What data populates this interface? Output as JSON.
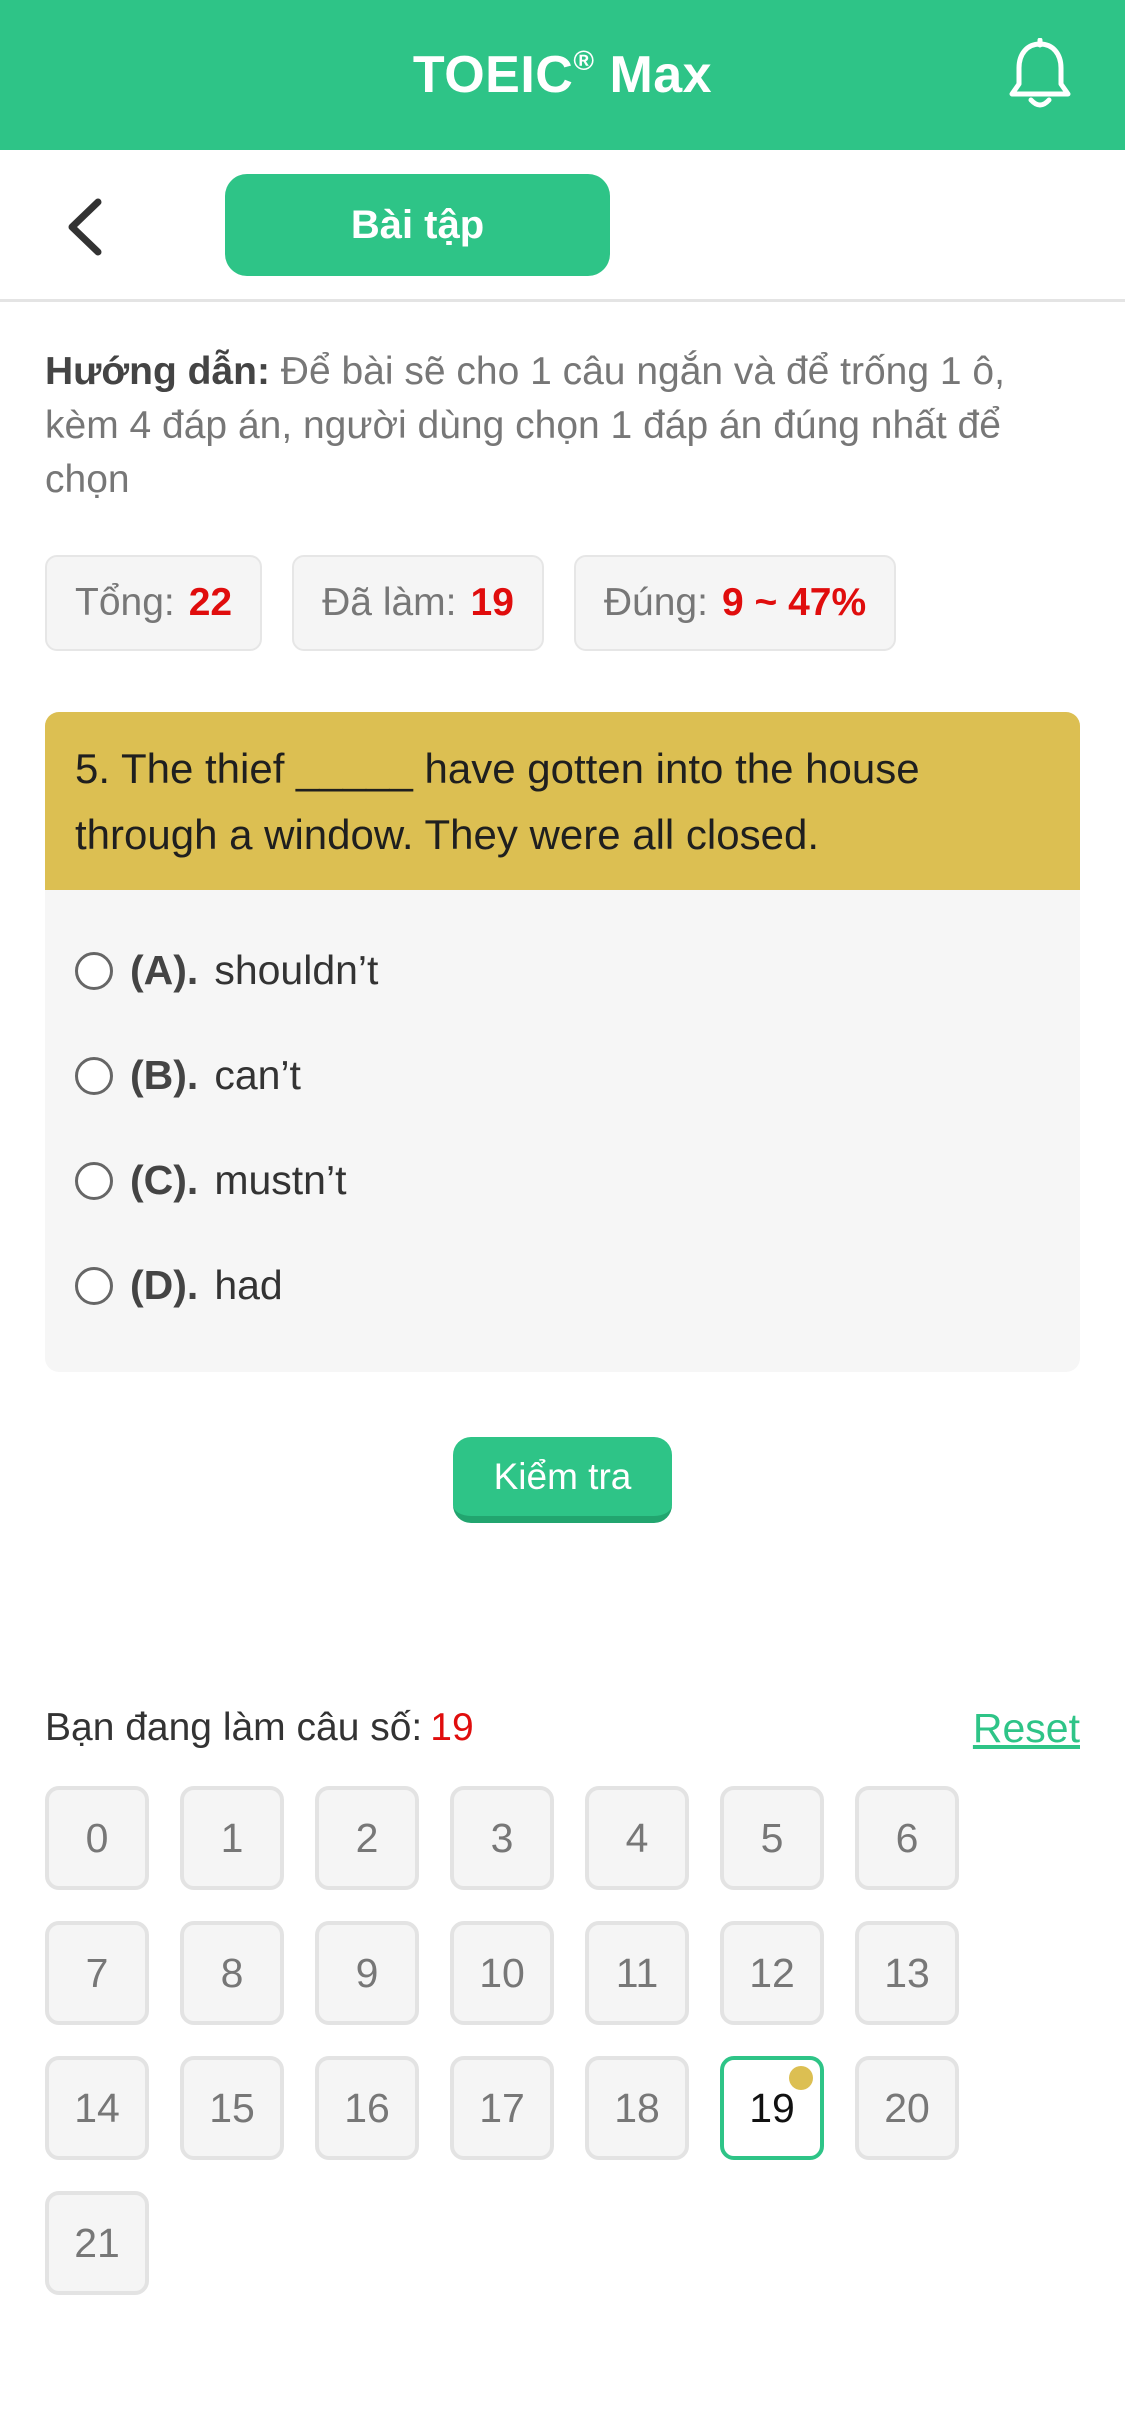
{
  "header": {
    "title": "TOEIC",
    "title_mark": "®",
    "title_suffix": " Max",
    "bg_color": "#2ec487",
    "bell_icon": "bell-icon"
  },
  "subbar": {
    "back_icon": "chevron-left-icon",
    "tab_label": "Bài tập"
  },
  "guide": {
    "label": "Hướng dẫn:",
    "text": "Để bài sẽ cho 1 câu ngắn và để trống 1 ô, kèm 4 đáp án, người dùng chọn 1 đáp án đúng nhất để chọn"
  },
  "stats": [
    {
      "label": "Tổng:",
      "value": "22"
    },
    {
      "label": "Đã làm:",
      "value": "19"
    },
    {
      "label": "Đúng:",
      "value": "9 ~ 47%"
    }
  ],
  "question": {
    "text": "5. The thief _____ have gotten into the house through a window. They were all closed.",
    "options": [
      {
        "letter": "(A).",
        "text": "shouldn’t"
      },
      {
        "letter": "(B).",
        "text": "can’t"
      },
      {
        "letter": "(C).",
        "text": "mustn’t"
      },
      {
        "letter": "(D).",
        "text": "had"
      }
    ]
  },
  "check_button": "Kiểm tra",
  "progress": {
    "label": "Bạn đang làm câu số:",
    "current": "19",
    "reset_label": "Reset"
  },
  "grid": {
    "items": [
      "0",
      "1",
      "2",
      "3",
      "4",
      "5",
      "6",
      "7",
      "8",
      "9",
      "10",
      "11",
      "12",
      "13",
      "14",
      "15",
      "16",
      "17",
      "18",
      "19",
      "20",
      "21"
    ],
    "active": "19"
  },
  "colors": {
    "accent": "#2ec487",
    "question_bg": "#dcbf52",
    "highlight_red": "#e00d0d"
  }
}
